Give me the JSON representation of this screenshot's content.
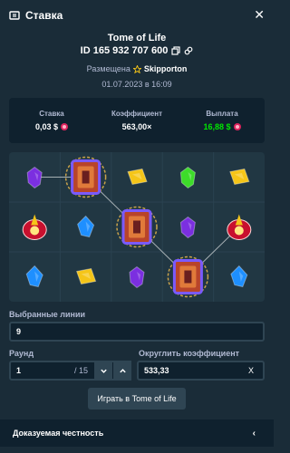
{
  "header": {
    "title": "Ставка",
    "close_icon": "close-icon",
    "ticket_icon": "ticket-icon"
  },
  "game": {
    "name": "Tome of Life",
    "bet_id": "ID 165 932 707 600",
    "placed_label": "Размещена",
    "user": "Skipporton",
    "date": "01.07.2023 в 16:09"
  },
  "stats": {
    "bet_label": "Ставка",
    "bet_value": "0,03 $",
    "multiplier_label": "Коэффициент",
    "multiplier_value": "563,00×",
    "payout_label": "Выплата",
    "payout_value": "16,88 $",
    "payout_color": "#00e701",
    "currency_icon": "coin-icon"
  },
  "board": {
    "cols": 5,
    "rows": 3,
    "symbols": [
      [
        "purple-gem",
        "tome",
        "yellow-gem",
        "green-gem",
        "yellow-gem"
      ],
      [
        "red-sun",
        "blue-gem",
        "tome",
        "purple-gem",
        "red-sun"
      ],
      [
        "blue-gem",
        "yellow-gem",
        "purple-gem",
        "tome",
        "blue-gem"
      ]
    ],
    "line_path": [
      [
        0,
        0
      ],
      [
        1,
        0
      ],
      [
        2,
        1
      ],
      [
        3,
        2
      ],
      [
        4,
        1
      ]
    ],
    "colors": {
      "purple": "#7b2fe0",
      "yellow": "#f5c518",
      "green": "#3ddc2a",
      "blue": "#1e8fff",
      "red": "#c8102e",
      "tome": "#b8442a",
      "tome_border": "#7a5aff",
      "line": "#ffffff"
    }
  },
  "lines": {
    "label": "Выбранные линии",
    "value": "9"
  },
  "round": {
    "label": "Раунд",
    "value": "1",
    "suffix": "/ 15",
    "prev_icon": "chevron-down-icon",
    "next_icon": "chevron-up-icon"
  },
  "round_mult": {
    "label": "Округлить коэффициент",
    "value": "533,33",
    "clear": "X"
  },
  "play_button": "Играть в Tome of Life",
  "footer": {
    "label": "Доказуемая честность",
    "chevron_icon": "chevron-left-icon"
  }
}
